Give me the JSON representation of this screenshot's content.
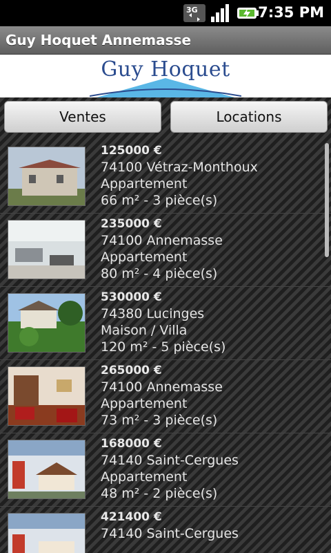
{
  "status": {
    "time": "7:35 PM",
    "network": "3G"
  },
  "app": {
    "title": "Guy Hoquet Annemasse"
  },
  "logo": {
    "text": "Guy Hoquet"
  },
  "buttons": {
    "ventes": "Ventes",
    "locations": "Locations"
  },
  "listings": [
    {
      "price": "125000 €",
      "location": "74100 Vétraz-Monthoux",
      "type": "Appartement",
      "details": "66 m² -   3 pièce(s)"
    },
    {
      "price": "235000 €",
      "location": "74100 Annemasse",
      "type": "Appartement",
      "details": "80 m² -   4 pièce(s)"
    },
    {
      "price": "530000 €",
      "location": "74380 Lucinges",
      "type": "Maison / Villa",
      "details": "120 m²   -   5 pièce(s)"
    },
    {
      "price": "265000 €",
      "location": "74100 Annemasse",
      "type": "Appartement",
      "details": "73 m² -   3 pièce(s)"
    },
    {
      "price": "168000 €",
      "location": "74140 Saint-Cergues",
      "type": "Appartement",
      "details": "48 m² -   2 pièce(s)"
    },
    {
      "price": "421400 €",
      "location": "74140 Saint-Cergues",
      "type": "",
      "details": ""
    }
  ]
}
